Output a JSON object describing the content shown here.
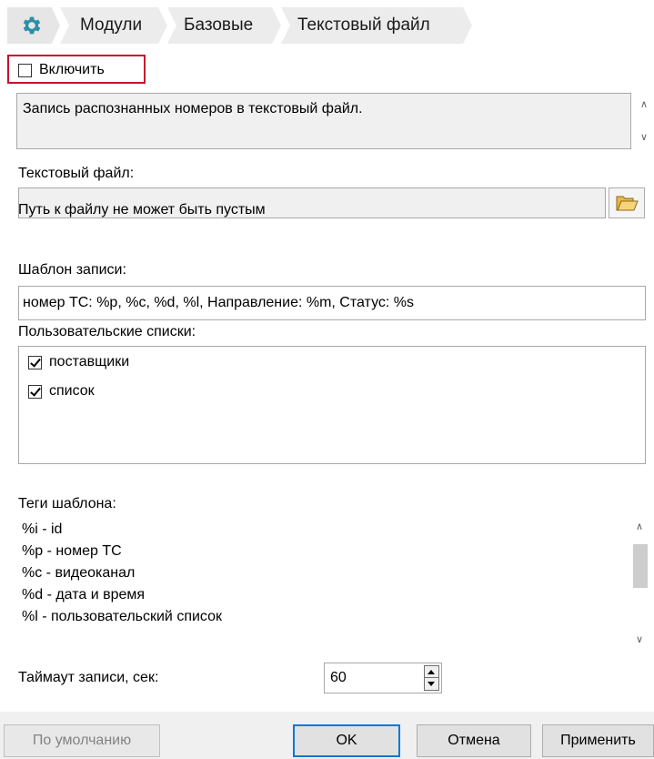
{
  "breadcrumb": {
    "items": [
      "Модули",
      "Базовые",
      "Текстовый файл"
    ]
  },
  "enable": {
    "label": "Включить",
    "checked": false
  },
  "description": "Запись распознанных номеров в текстовый файл.",
  "file": {
    "label": "Текстовый файл:",
    "value": "",
    "error": "Путь к файлу не может быть пустым"
  },
  "template": {
    "label": "Шаблон записи:",
    "value": "номер ТС: %p, %c, %d, %l, Направление: %m, Статус: %s"
  },
  "user_lists": {
    "label": "Пользовательские списки:",
    "items": [
      {
        "label": "поставщики",
        "checked": true
      },
      {
        "label": "список",
        "checked": true
      }
    ]
  },
  "tags": {
    "label": "Теги шаблона:",
    "items": [
      "%i - id",
      "%p - номер ТС",
      "%c - видеоканал",
      "%d - дата и время",
      "%l - пользовательский список"
    ]
  },
  "timeout": {
    "label": "Таймаут записи, сек:",
    "value": "60"
  },
  "buttons": {
    "defaults": "По умолчанию",
    "ok": "OK",
    "cancel": "Отмена",
    "apply": "Применить"
  },
  "colors": {
    "highlight": "#c8102e",
    "accent": "#0078d7",
    "gear": "#2d8fa6"
  }
}
